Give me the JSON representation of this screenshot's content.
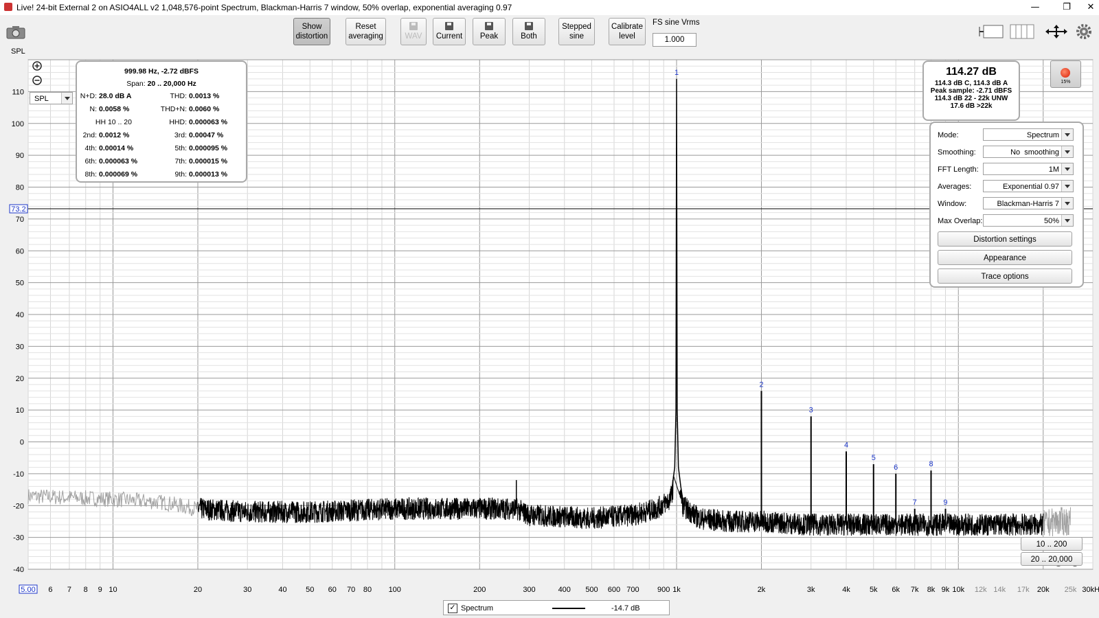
{
  "window": {
    "title": "Live! 24-bit External 2 on ASIO4ALL v2 1,048,576-point Spectrum, Blackman-Harris 7 window, 50% overlap, exponential averaging 0.97",
    "controls": {
      "minimize": "—",
      "restore": "❐",
      "close": "✕"
    }
  },
  "toolbar": {
    "spl_label": "SPL",
    "buttons": [
      {
        "id": "show-distortion",
        "label1": "Show",
        "label2": "distortion",
        "pressed": true
      },
      {
        "id": "reset-averaging",
        "label1": "Reset",
        "label2": "averaging"
      },
      {
        "id": "wav",
        "label1": "",
        "label2": "WAV",
        "disabled": true
      },
      {
        "id": "current",
        "label1": "",
        "label2": "Current"
      },
      {
        "id": "peak",
        "label1": "",
        "label2": "Peak"
      },
      {
        "id": "both",
        "label1": "",
        "label2": "Both"
      },
      {
        "id": "stepped-sine",
        "label1": "Stepped",
        "label2": "sine"
      },
      {
        "id": "calibrate-level",
        "label1": "Calibrate",
        "label2": "level"
      }
    ],
    "fs_sine_label": "FS sine Vrms",
    "fs_sine_value": "1.000"
  },
  "plot": {
    "spl_selector": "SPL",
    "cursor_level": "73.2",
    "x_start_label": "5.00",
    "y_ticks": [
      "110",
      "100",
      "90",
      "80",
      "70",
      "60",
      "50",
      "40",
      "30",
      "20",
      "10",
      "0",
      "-10",
      "-20",
      "-30",
      "-40"
    ],
    "x_ticks": [
      "6",
      "7",
      "8",
      "9",
      "10",
      "20",
      "30",
      "40",
      "50",
      "60",
      "70",
      "80",
      "100",
      "200",
      "300",
      "400",
      "500",
      "600",
      "700",
      "900",
      "1k",
      "2k",
      "3k",
      "4k",
      "5k",
      "6k",
      "7k",
      "8k",
      "9k",
      "10k",
      "12k",
      "14k",
      "17k",
      "20k",
      "25k",
      "30kHz"
    ],
    "harmonic_markers": [
      "1",
      "2",
      "3",
      "4",
      "5",
      "6",
      "7",
      "8",
      "9"
    ]
  },
  "distortion_box": {
    "header": "999.98 Hz, -2.72 dBFS",
    "span_label": "Span:",
    "span_value": "20 .. 20,000 Hz",
    "rows": [
      {
        "l1": "N+D:",
        "v1": "28.0 dB A",
        "l2": "THD:",
        "v2": "0.0013 %"
      },
      {
        "l1": "N:",
        "v1": "0.0058 %",
        "l2": "THD+N:",
        "v2": "0.0060 %"
      },
      {
        "l1": "HH 10 .. 20",
        "v1": "",
        "l2": "HHD:",
        "v2": "0.000063 %"
      },
      {
        "l1": "2nd:",
        "v1": "0.0012 %",
        "l2": "3rd:",
        "v2": "0.00047 %"
      },
      {
        "l1": "4th:",
        "v1": "0.00014 %",
        "l2": "5th:",
        "v2": "0.000095 %"
      },
      {
        "l1": "6th:",
        "v1": "0.000063 %",
        "l2": "7th:",
        "v2": "0.000015 %"
      },
      {
        "l1": "8th:",
        "v1": "0.000069 %",
        "l2": "9th:",
        "v2": "0.000013 %"
      }
    ]
  },
  "level_box": {
    "main": "114.27 dB",
    "line1": "114.3 dB C, 114.3 dB A",
    "line2": "Peak sample: -2.71 dBFS",
    "line3": "114.3 dB 22 - 22k UNW",
    "line4": "17.6 dB >22k"
  },
  "record": {
    "percent": "15%"
  },
  "controls": {
    "rows": [
      {
        "label": "Mode:",
        "value": "Spectrum"
      },
      {
        "label": "Smoothing:",
        "value": "No  smoothing"
      },
      {
        "label": "FFT Length:",
        "value": "1M"
      },
      {
        "label": "Averages:",
        "value": "Exponential 0.97"
      },
      {
        "label": "Window:",
        "value": "Blackman-Harris 7"
      },
      {
        "label": "Max Overlap:",
        "value": "50%"
      }
    ],
    "buttons": [
      "Distortion settings",
      "Appearance",
      "Trace options"
    ]
  },
  "range_buttons": [
    "10 .. 200",
    "20 .. 20,000"
  ],
  "legend": {
    "name": "Spectrum",
    "value": "-14.7 dB",
    "checked": true
  },
  "chart_data": {
    "type": "line",
    "xscale": "log",
    "xlim": [
      5,
      30000
    ],
    "ylim": [
      -40,
      120
    ],
    "ylabel": "SPL",
    "x_unit": "Hz",
    "fundamental_hz": 1000,
    "series": [
      {
        "name": "Spectrum",
        "x": [
          5,
          10,
          15,
          20,
          30,
          50,
          100,
          200,
          250,
          270,
          300,
          500,
          700,
          850,
          950,
          980,
          1000,
          1020,
          1050,
          1200,
          1500,
          2000,
          3000,
          4000,
          5000,
          6000,
          7000,
          8000,
          9000,
          10000,
          15000,
          20000,
          22000,
          25000
        ],
        "y": [
          -17,
          -18,
          -19,
          -21,
          -22,
          -22,
          -21,
          -21,
          -21,
          -21,
          -23,
          -24,
          -23,
          -21,
          -18,
          -13,
          114,
          -13,
          -20,
          -24,
          -25,
          -25,
          -26,
          -26,
          -26,
          -26,
          -26,
          -26,
          -26,
          -26,
          -26,
          -26,
          -25,
          -25
        ]
      }
    ],
    "harmonics": [
      {
        "n": 1,
        "hz": 1000,
        "db": 114
      },
      {
        "n": 2,
        "hz": 2000,
        "db": 16
      },
      {
        "n": 3,
        "hz": 3000,
        "db": 8
      },
      {
        "n": 4,
        "hz": 4000,
        "db": -3
      },
      {
        "n": 5,
        "hz": 5000,
        "db": -7
      },
      {
        "n": 6,
        "hz": 6000,
        "db": -10
      },
      {
        "n": 7,
        "hz": 7000,
        "db": -21
      },
      {
        "n": 8,
        "hz": 8000,
        "db": -9
      },
      {
        "n": 9,
        "hz": 9000,
        "db": -21
      }
    ],
    "spurs": [
      {
        "hz": 270,
        "db": -12
      }
    ]
  }
}
